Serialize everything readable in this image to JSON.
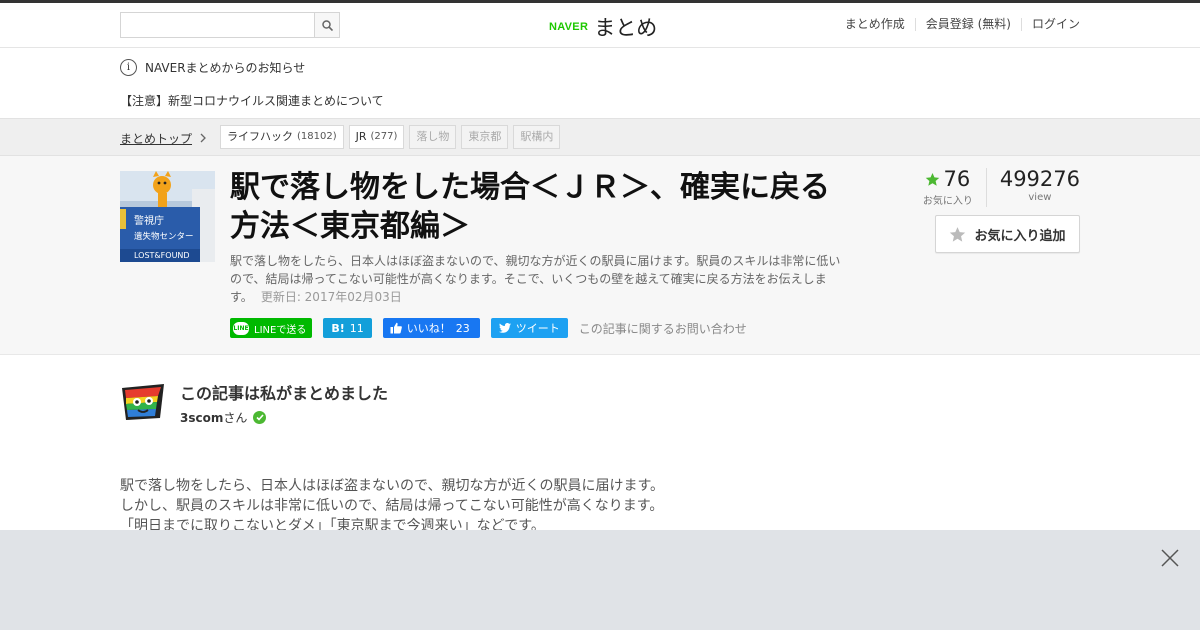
{
  "header": {
    "search_placeholder": "",
    "logo_naver": "NAVER",
    "logo_matome": "まとめ",
    "links": [
      "まとめ作成",
      "会員登録 (無料)",
      "ログイン"
    ]
  },
  "notice": {
    "heading": "NAVERまとめからのお知らせ",
    "item": "【注意】新型コロナウイルス関連まとめについて"
  },
  "breadcrumb": {
    "top": "まとめトップ",
    "tags": [
      {
        "label": "ライフハック",
        "count": "(18102)"
      },
      {
        "label": "JR",
        "count": "(277)"
      },
      {
        "label": "落し物",
        "count": ""
      },
      {
        "label": "東京都",
        "count": ""
      },
      {
        "label": "駅構内",
        "count": ""
      }
    ]
  },
  "article": {
    "thumb_sign_1": "警視庁",
    "thumb_sign_2": "遺失物センター",
    "thumb_sign_3": "LOST&FOUND",
    "title": "駅で落し物をした場合＜ＪＲ＞、確実に戻る方法＜東京都編＞",
    "description": "駅で落し物をしたら、日本人はほぼ盗まないので、親切な方が近くの駅員に届けます。駅員のスキルは非常に低いので、結局は帰ってこない可能性が高くなります。そこで、いくつもの壁を越えて確実に戻る方法をお伝えします。",
    "updated": "更新日: 2017年02月03日",
    "share": {
      "line_badge": "LINE",
      "line": "LINEで送る",
      "hatena_icon": "B!",
      "hatena_count": "11",
      "facebook": "いいね！",
      "facebook_count": "23",
      "twitter": "ツイート"
    },
    "contact": "この記事に関するお問い合わせ",
    "favorites_count": "76",
    "favorites_label": "お気に入り",
    "views_count": "499276",
    "views_label": "view",
    "fav_button": "お気に入り追加"
  },
  "author": {
    "heading": "この記事は私がまとめました",
    "name": "3scom",
    "suffix": "さん"
  },
  "body": {
    "lines": [
      "駅で落し物をしたら、日本人はほぼ盗まないので、親切な方が近くの駅員に届けます。",
      "しかし、駅員のスキルは非常に低いので、結局は帰ってこない可能性が高くなります。",
      "「明日までに取りこないとダメ」「東京駅まで今週来い」などです。"
    ]
  },
  "colors": {
    "naver_green": "#1ec800",
    "line_green": "#00b900",
    "hatena_blue": "#139fda",
    "facebook_blue": "#1877f2",
    "twitter_blue": "#1da1f2",
    "star_green": "#4cb832",
    "overlay_gray": "#e0e3e7"
  },
  "icons": [
    "search-icon",
    "info-icon",
    "chevron-right-icon",
    "star-icon",
    "verified-icon",
    "close-icon",
    "twitter-bird-icon",
    "thumbs-up-icon"
  ]
}
